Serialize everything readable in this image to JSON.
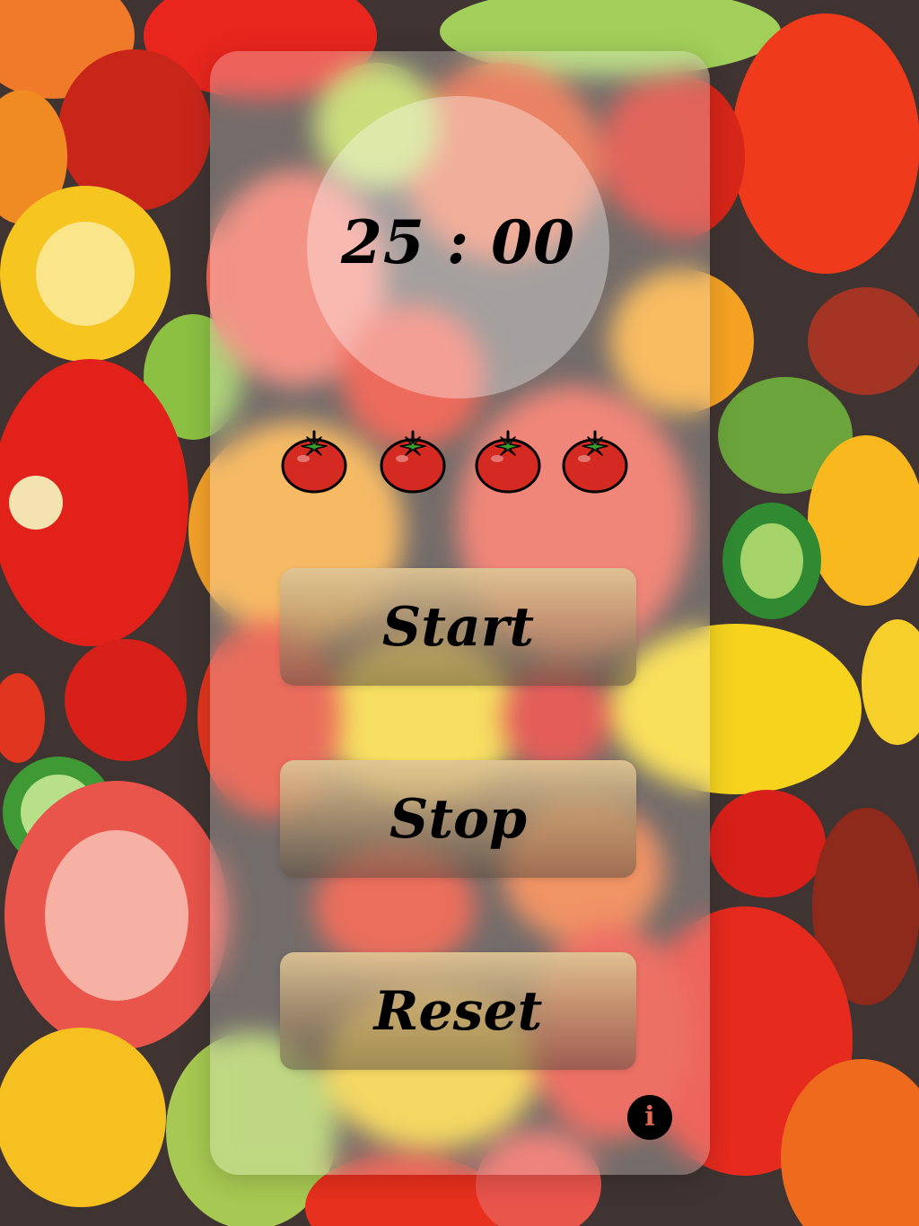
{
  "timer": {
    "display": "25 : 00"
  },
  "pomodoros": {
    "count": 4,
    "icon": "tomato-icon"
  },
  "buttons": {
    "start_label": "Start",
    "stop_label": "Stop",
    "reset_label": "Reset"
  },
  "info": {
    "icon": "info-icon",
    "glyph": "i"
  },
  "colors": {
    "tomato_red": "#d42a22",
    "tomato_stem": "#3d9a2c",
    "button_top": "#dec494",
    "info_glyph": "#e36b54"
  }
}
